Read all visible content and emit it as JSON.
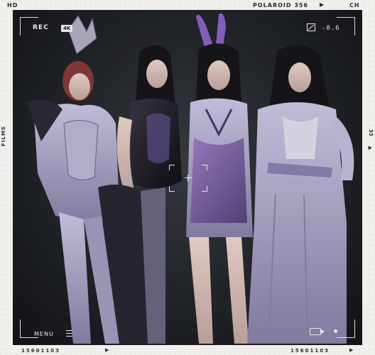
{
  "frame": {
    "top_left_label": "HD",
    "top_brand_label": "POLAROID 356",
    "top_arrow": "▶",
    "top_right_label": "CH",
    "left_side_label": "FILMS",
    "right_side_label": "33",
    "right_side_arrow": "▶",
    "bottom_left_code": "15601103",
    "bottom_left_arrow": "▶",
    "bottom_right_code": "15601103",
    "bottom_right_arrow": "▶"
  },
  "viewfinder": {
    "rec_label": "REC",
    "resolution_badge": "4K",
    "exposure_value": "-0.6",
    "menu_label": "MENU"
  },
  "photo": {
    "subject": "four-women-in-costume",
    "colors": {
      "background": "#23262b",
      "costume_lavender": "#b9b3d6",
      "costume_purple": "#7b5aa8",
      "costume_black": "#1b1b22",
      "skin": "#e8cfc6",
      "hair_dark": "#16161c",
      "hair_red": "#8a3b3b"
    }
  }
}
